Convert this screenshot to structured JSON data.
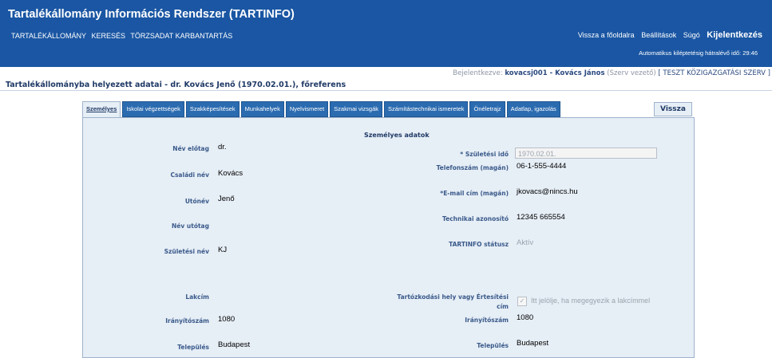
{
  "header": {
    "title": "Tartalékállomány Információs Rendszer (TARTINFO)",
    "menu": [
      "TARTALÉKÁLLOMÁNY",
      "KERESÉS",
      "TÖRZSADAT KARBANTARTÁS"
    ],
    "right_menu": {
      "home": "Vissza a főoldalra",
      "settings": "Beállítások",
      "help": "Súgó",
      "logout": "Kijelentkezés"
    },
    "timer": "Automatikus kiléptetésig hátralévő idő: 29:46"
  },
  "login": {
    "prefix": "Bejelentkezve:",
    "user": "kovacsj001 - Kovács János",
    "role": "(Szerv vezető)",
    "org": "[ TESZT KÖZIGAZGATÁSI SZERV ]"
  },
  "page_title": "Tartalékállományba helyezett adatai - dr. Kovács Jenő (1970.02.01.), főreferens",
  "tabs": [
    "Személyes",
    "Iskolai végzettségek",
    "Szakképesítések",
    "Munkahelyek",
    "Nyelvismeret",
    "Szakmai vizsgák",
    "Számítástechnikai ismeretek",
    "Önéletrajz",
    "Adatlap, igazolás"
  ],
  "back_button": "Vissza",
  "section_title": "Személyes adatok",
  "left": {
    "prefix_label": "Név előtag",
    "prefix_value": "dr.",
    "family_label": "Családi név",
    "family_value": "Kovács",
    "given_label": "Utónév",
    "given_value": "Jenő",
    "suffix_label": "Név utótag",
    "birthname_label": "Születési név",
    "birthname_value": "KJ",
    "address_label": "Lakcím",
    "zip_label": "Irányítószám",
    "zip_value": "1080",
    "city_label": "Település",
    "city_value": "Budapest"
  },
  "right": {
    "birthdate_label": "* Születési idő",
    "birthdate_value": "1970.02.01.",
    "phone_label": "Telefonszám (magán)",
    "phone_value": "06-1-555-4444",
    "email_label": "*E-mail cím (magán)",
    "email_value": "jkovacs@nincs.hu",
    "tech_label": "Technikai azonosító",
    "tech_value": "12345 665554",
    "status_label": "TARTINFO státusz",
    "status_value": "Aktív",
    "residence_label_1": "Tartózkodási hely vagy Értesítési",
    "residence_label_2": "cím",
    "residence_check_label": "Itt jelölje, ha megegyezik a lakcímmel",
    "zip_label": "Irányítószám",
    "zip_value": "1080",
    "city_label": "Település",
    "city_value": "Budapest"
  }
}
